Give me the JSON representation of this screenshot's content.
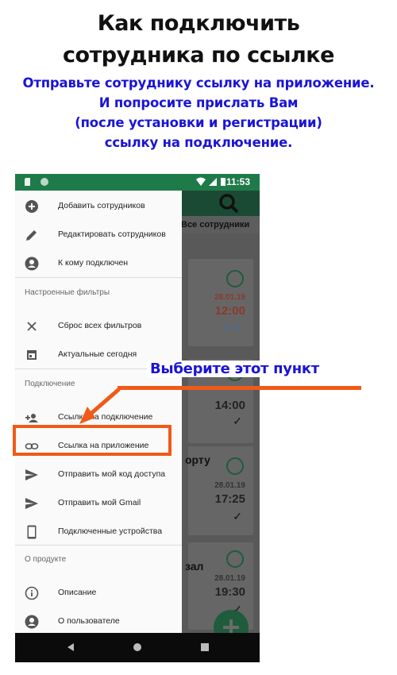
{
  "header": {
    "title_line1": "Как подключить",
    "title_line2": "сотрудника по ссылке",
    "subtitle_line1": "Отправьте сотруднику ссылку на приложение.",
    "subtitle_line2": "И попросите прислать Вам",
    "subtitle_line3": "(после установки и регистрации)",
    "subtitle_line4": "ссылку на подключение."
  },
  "statusbar": {
    "time": "11:53"
  },
  "app": {
    "tab_label": "Все сотрудники",
    "cards": [
      {
        "date": "28.01.19",
        "time": "12:00",
        "word": ""
      },
      {
        "date": "",
        "time": "14:00",
        "word": ""
      },
      {
        "date": "28.01.19",
        "time": "17:25",
        "word": "орту"
      },
      {
        "date": "28.01.19",
        "time": "19:30",
        "word": "зал"
      }
    ]
  },
  "drawer": {
    "items_top": [
      {
        "label": "Добавить сотрудников",
        "icon": "add-circle-icon"
      },
      {
        "label": "Редактировать сотрудников",
        "icon": "edit-pencil-icon"
      },
      {
        "label": "К кому подключен",
        "icon": "person-badge-icon"
      }
    ],
    "section_filters": "Настроенные фильтры",
    "items_filters": [
      {
        "label": "Сброс всех фильтров",
        "icon": "close-icon"
      },
      {
        "label": "Актуальные сегодня",
        "icon": "calendar-icon"
      }
    ],
    "section_connection": "Подключение",
    "items_connection": [
      {
        "label": "Ссылка на подключение",
        "icon": "person-add-icon"
      },
      {
        "label": "Ссылка на приложение",
        "icon": "link-icon"
      },
      {
        "label": "Отправить мой код доступа",
        "icon": "send-icon"
      },
      {
        "label": "Отправить мой Gmail",
        "icon": "send-icon"
      },
      {
        "label": "Подключенные устройства",
        "icon": "phone-device-icon"
      }
    ],
    "section_about": "О продукте",
    "items_about": [
      {
        "label": "Описание",
        "icon": "info-icon"
      },
      {
        "label": "О пользователе",
        "icon": "person-badge-icon"
      }
    ]
  },
  "callout": {
    "text": "Выберите этот пункт",
    "color": "#1a14d6",
    "accent": "#f05a18"
  },
  "colors": {
    "statusbar": "#1f7a4a",
    "appbar": "#1b4a34",
    "brand_green": "#1e5c3c"
  }
}
